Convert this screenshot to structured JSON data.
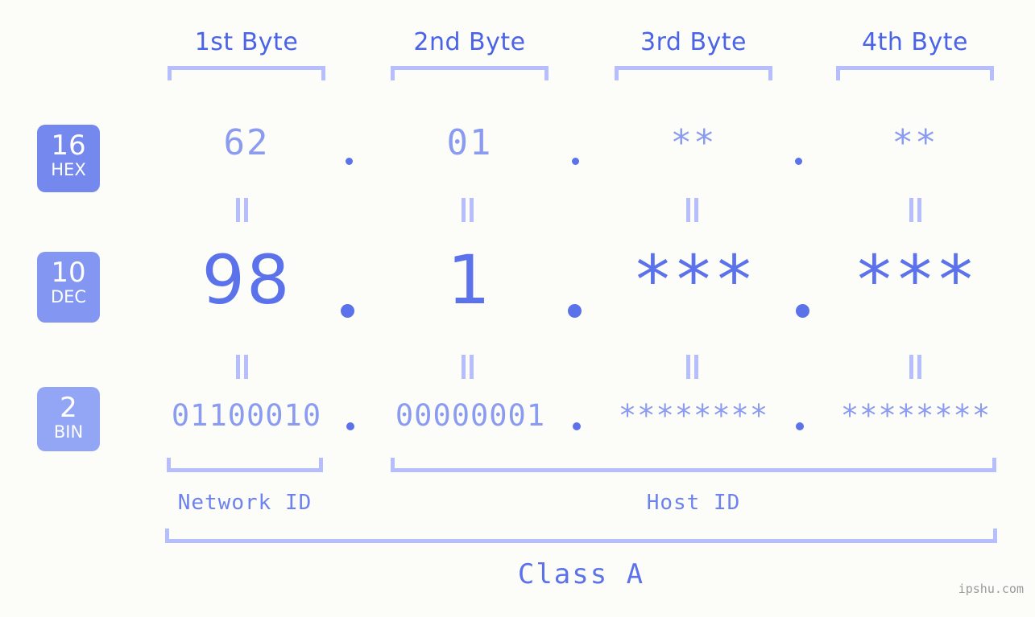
{
  "background": "#fcfdf8",
  "accent": "#5b72eb",
  "accent_light": "#8b9bf0",
  "bracket_color": "#b6befd",
  "header": {
    "bytes": [
      {
        "label": "1st Byte"
      },
      {
        "label": "2nd Byte"
      },
      {
        "label": "3rd Byte"
      },
      {
        "label": "4th Byte"
      }
    ]
  },
  "bases": [
    {
      "num": "16",
      "name": "HEX",
      "color": "#7488ee"
    },
    {
      "num": "10",
      "name": "DEC",
      "color": "#8296f2"
    },
    {
      "num": "2",
      "name": "BIN",
      "color": "#93a6f6"
    }
  ],
  "rows": {
    "hex": {
      "values": [
        "62",
        "01",
        "**",
        "**"
      ]
    },
    "dec": {
      "values": [
        "98",
        "1",
        "***",
        "***"
      ]
    },
    "bin": {
      "values": [
        "01100010",
        "00000001",
        "********",
        "********"
      ]
    }
  },
  "separators": {
    "dot": "."
  },
  "sections": {
    "network_id": "Network ID",
    "host_id": "Host ID",
    "class": "Class A"
  },
  "watermark": "ipshu.com"
}
